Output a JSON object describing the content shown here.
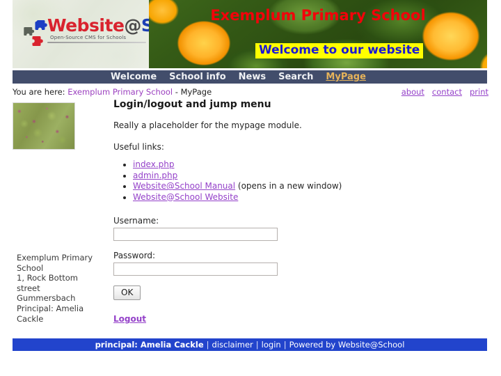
{
  "header": {
    "logo": {
      "word_web": "Websi",
      "word_te": "te",
      "word_at": "@",
      "word_school": "School",
      "registered": "®",
      "tagline": "Open-Source CMS for Schools"
    },
    "school_title": "Exemplum Primary School",
    "welcome_banner": "Welcome to our website"
  },
  "nav": {
    "items": [
      {
        "label": "Welcome",
        "active": false
      },
      {
        "label": "School info",
        "active": false
      },
      {
        "label": "News",
        "active": false
      },
      {
        "label": "Search",
        "active": false
      },
      {
        "label": "MyPage",
        "active": true
      }
    ]
  },
  "breadcrumb": {
    "prefix": "You are here:",
    "root_link": "Exemplum Primary School",
    "separator": " - ",
    "current": "MyPage"
  },
  "toplinks": [
    {
      "label": "about"
    },
    {
      "label": "contact"
    },
    {
      "label": "print"
    }
  ],
  "sidebar": {
    "address": "Exemplum Primary School\n1, Rock Bottom street\nGummersbach\nPrincipal: Amelia Cackle"
  },
  "main": {
    "title": "Login/logout and jump menu",
    "intro": "Really a placeholder for the mypage module.",
    "links_heading": "Useful links:",
    "links": [
      {
        "label": "index.php",
        "suffix": ""
      },
      {
        "label": "admin.php",
        "suffix": ""
      },
      {
        "label": "Website@School Manual",
        "suffix": " (opens in a new window)"
      },
      {
        "label": "Website@School Website",
        "suffix": ""
      }
    ],
    "form": {
      "username_label": "Username:",
      "username_value": "",
      "username_placeholder": "",
      "password_label": "Password:",
      "password_value": "",
      "password_placeholder": "",
      "submit_label": "OK",
      "logout_label": "Logout"
    }
  },
  "footer": {
    "principal": "principal: Amelia Cackle",
    "sep": "|",
    "disclaimer": "disclaimer",
    "login": "login",
    "powered": "Powered by Website@School"
  },
  "colors": {
    "nav_bar": "#18264a",
    "nav_active": "#e6b35a",
    "school_title": "#f2030a",
    "welcome_bg": "#ffff00",
    "welcome_fg": "#1a17d6",
    "link_purple": "#9441c9",
    "footer_bg": "#2244cc"
  }
}
